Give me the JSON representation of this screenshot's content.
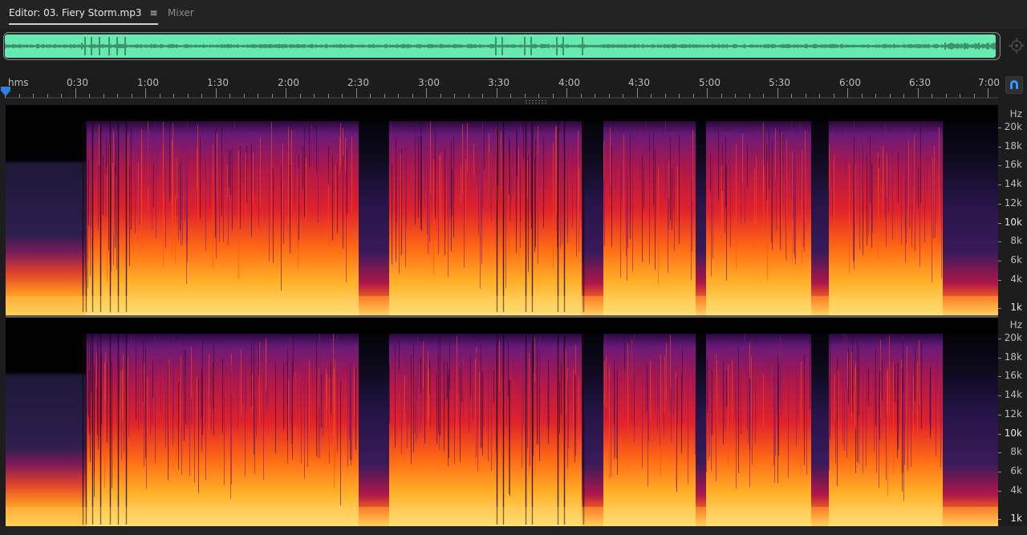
{
  "tabs": {
    "editor_label": "Editor: 03. Fiery Storm.mp3",
    "menu_glyph": "≡",
    "mixer_label": "Mixer"
  },
  "overview": {
    "waveform_color": "#66eab0",
    "zoom_icon": "zoom-navigator-icon"
  },
  "timeline": {
    "unit_label": "hms",
    "marks": [
      "0:30",
      "1:00",
      "1:30",
      "2:00",
      "2:30",
      "3:00",
      "3:30",
      "4:00",
      "4:30",
      "5:00",
      "5:30",
      "6:00",
      "6:30",
      "7:00"
    ],
    "playhead_color": "#2f7fe0",
    "snap_icon": "magnet-snap-icon"
  },
  "frequency_axis": {
    "unit": "Hz",
    "labels": [
      "20k",
      "18k",
      "16k",
      "14k",
      "12k",
      "10k",
      "8k",
      "6k",
      "4k",
      "1k"
    ]
  },
  "spectrogram": {
    "channels": [
      "top",
      "bottom"
    ],
    "palette": [
      "#000000",
      "#2a0a40",
      "#5a1a78",
      "#9a1a6a",
      "#d81d2e",
      "#ff5a10",
      "#ffaa20",
      "#ffe070"
    ]
  }
}
